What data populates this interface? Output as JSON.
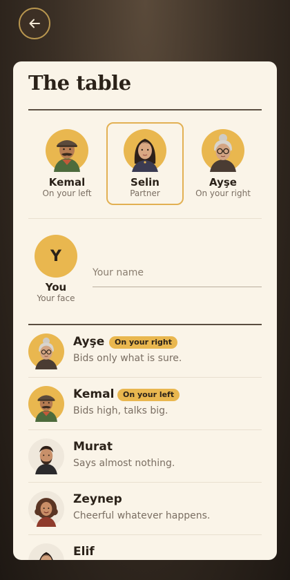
{
  "header": {
    "back_icon": "arrow-left-icon"
  },
  "panel": {
    "title": "The table"
  },
  "seats": [
    {
      "name": "Kemal",
      "role": "On your left",
      "avatar": "man-flat-cap-mustache",
      "selected": false
    },
    {
      "name": "Selin",
      "role": "Partner",
      "avatar": "young-woman-dark-hair",
      "selected": true
    },
    {
      "name": "Ayşe",
      "role": "On your right",
      "avatar": "grandmother-glasses-bun",
      "selected": false
    }
  ],
  "you": {
    "initial": "Y",
    "label": "You",
    "sublabel": "Your face",
    "name_value": "",
    "name_placeholder": "Your name"
  },
  "players": [
    {
      "name": "Ayşe",
      "badge": "On your right",
      "desc": "Bids only what is sure.",
      "avatar": "grandmother-glasses-bun"
    },
    {
      "name": "Kemal",
      "badge": "On your left",
      "desc": "Bids high, talks big.",
      "avatar": "man-flat-cap-mustache"
    },
    {
      "name": "Murat",
      "badge": "",
      "desc": "Says almost nothing.",
      "avatar": "young-man-beard"
    },
    {
      "name": "Zeynep",
      "badge": "",
      "desc": "Cheerful whatever happens.",
      "avatar": "woman-curly-hair"
    },
    {
      "name": "Elif",
      "badge": "",
      "desc": "",
      "avatar": "woman-dark-hair"
    }
  ],
  "colors": {
    "accent": "#e9b74f",
    "panel": "#faf4e8",
    "background": "#3a2f25",
    "text": "#2b2219",
    "muted": "#7a6e62"
  }
}
